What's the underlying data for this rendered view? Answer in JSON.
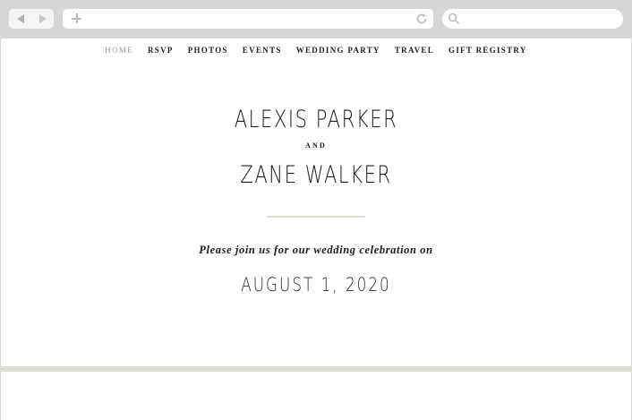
{
  "browser": {
    "address_value": "",
    "search_value": ""
  },
  "nav": {
    "items": [
      {
        "label": "HOME",
        "active": true
      },
      {
        "label": "RSVP",
        "active": false
      },
      {
        "label": "PHOTOS",
        "active": false
      },
      {
        "label": "EVENTS",
        "active": false
      },
      {
        "label": "WEDDING PARTY",
        "active": false
      },
      {
        "label": "TRAVEL",
        "active": false
      },
      {
        "label": "GIFT REGISTRY",
        "active": false
      }
    ]
  },
  "hero": {
    "name_one": "ALEXIS PARKER",
    "conjunction": "AND",
    "name_two": "ZANE WALKER",
    "invitation": "Please join us for our wedding celebration on",
    "date": "AUGUST 1, 2020"
  },
  "colors": {
    "chrome": "#d6d6d6",
    "accent_band": "#dcddd3",
    "active_nav": "#9a9a9a",
    "text": "#1c1c1c"
  }
}
